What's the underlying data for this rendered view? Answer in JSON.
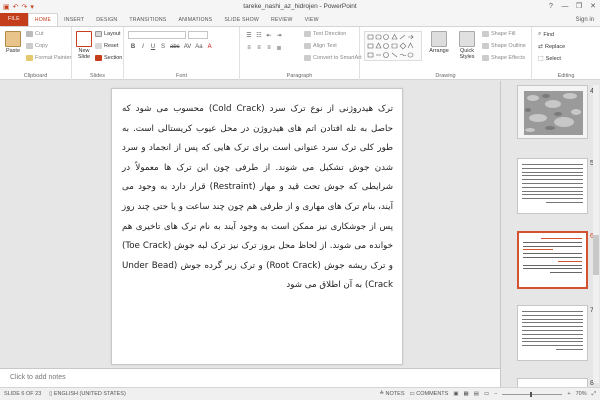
{
  "window": {
    "title": "tareke_nashi_az_hidrojen - PowerPoint",
    "controls": {
      "help": "?",
      "minimize": "—",
      "restore": "❐",
      "close": "✕"
    },
    "sign_in": "Sign in"
  },
  "quick_access": {
    "save": "▣",
    "undo": "↶",
    "redo": "↷",
    "customize": "▾"
  },
  "tabs": [
    "FILE",
    "HOME",
    "INSERT",
    "DESIGN",
    "TRANSITIONS",
    "ANIMATIONS",
    "SLIDE SHOW",
    "REVIEW",
    "VIEW"
  ],
  "active_tab": "HOME",
  "ribbon": {
    "clipboard": {
      "name": "Clipboard",
      "paste": "Paste",
      "cut": "Cut",
      "copy": "Copy",
      "format_painter": "Format Painter"
    },
    "slides": {
      "name": "Slides",
      "new_slide": "New Slide",
      "layout": "Layout",
      "reset": "Reset",
      "section": "Section"
    },
    "font": {
      "name": "Font",
      "buttons": [
        "B",
        "I",
        "U",
        "S",
        "abc",
        "AV",
        "Aa",
        "A"
      ]
    },
    "paragraph": {
      "name": "Paragraph",
      "text_direction": "Text Direction",
      "align_text": "Align Text",
      "convert_smartart": "Convert to SmartArt"
    },
    "drawing": {
      "name": "Drawing",
      "arrange": "Arrange",
      "quick_styles": "Quick Styles",
      "shape_fill": "Shape Fill",
      "shape_outline": "Shape Outline",
      "shape_effects": "Shape Effects"
    },
    "editing": {
      "name": "Editing",
      "find": "Find",
      "replace": "Replace",
      "select": "Select"
    }
  },
  "slide": {
    "text": "ترک هیدروژنی از نوع ترک سرد (Cold Crack) محسوب می شود که حاصل به تله افتادن اتم های هیدروژن در محل عیوب کریستالی است. به طور کلی ترک سرد عنوانی است برای ترک هایی که پس از انجماد و سرد شدن جوش تشکیل می شوند. از طرفی چون این ترک ها معمولاً در شرایطی که جوش تحت قید و مهار (Restraint) قرار دارد به وجود می آیند، بنام ترک های مهاری و از طرفی هم چون چند ساعت و یا حتی چند روز پس از جوشکاری نیز ممکن است به وجود آیند به نام ترک های تاخیری هم خوانده می شوند. از لحاظ محل بروز ترک نیز ترک لبه جوش (Toe Crack) و ترک ریشه جوش (Root Crack) و ترک زیر گرده جوش (Under Bead Crack) به آن اطلاق می شود"
  },
  "notes_placeholder": "Click to add notes",
  "thumbnails": [
    {
      "number": "4"
    },
    {
      "number": "5"
    },
    {
      "number": "6",
      "selected": true
    },
    {
      "number": "7"
    },
    {
      "number": "8"
    }
  ],
  "status": {
    "slide_indicator": "SLIDE 6 OF 23",
    "language": "ENGLISH (UNITED STATES)",
    "notes": "NOTES",
    "comments": "COMMENTS",
    "zoom": "70%"
  },
  "colors": {
    "accent": "#c43e1c",
    "selection": "#d35230"
  }
}
